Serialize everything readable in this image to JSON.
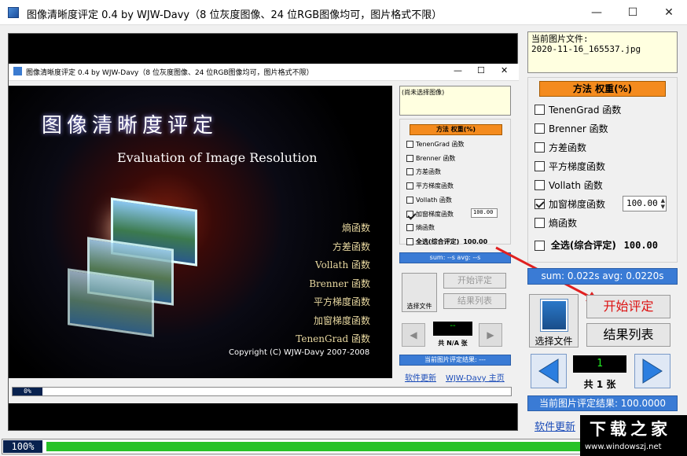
{
  "window": {
    "title": "图像清晰度评定 0.4 by WJW-Davy（8 位灰度图像、24 位RGB图像均可，图片格式不限）",
    "minimize": "—",
    "maximize": "☐",
    "close": "✕"
  },
  "current_file": {
    "label": "当前图片文件:",
    "value": "2020-11-16_165537.jpg"
  },
  "methods": {
    "header": "方法  权重(%)",
    "items": [
      {
        "label": "TenenGrad 函数",
        "checked": false
      },
      {
        "label": "Brenner 函数",
        "checked": false
      },
      {
        "label": "方差函数",
        "checked": false
      },
      {
        "label": "平方梯度函数",
        "checked": false
      },
      {
        "label": "Vollath 函数",
        "checked": false
      },
      {
        "label": "加窗梯度函数",
        "checked": true
      },
      {
        "label": "熵函数",
        "checked": false
      }
    ],
    "weight": "100.00",
    "select_all": "全选(综合评定)",
    "select_all_value": "100.00"
  },
  "stats": "sum: 0.022s  avg: 0.0220s",
  "buttons": {
    "choose_file": "选择文件",
    "start": "开始评定",
    "results": "结果列表"
  },
  "nav": {
    "counter": "1",
    "total": "共 1 张"
  },
  "result_bar": "当前图片评定结果: 100.0000",
  "links": {
    "update": "软件更新"
  },
  "progress": {
    "outer_label": "100%",
    "outer_value": 1.0
  },
  "inner": {
    "title": "图像清晰度评定 0.4 by WJW-Davy（8 位灰度图像、24 位RGB图像均可，图片格式不限）",
    "note": "(尚未选择图像)",
    "methods_header": "方法  权重(%)",
    "items": [
      {
        "label": "TenenGrad 函数",
        "checked": false
      },
      {
        "label": "Brenner 函数",
        "checked": false
      },
      {
        "label": "方差函数",
        "checked": false
      },
      {
        "label": "平方梯度函数",
        "checked": false
      },
      {
        "label": "Vollath 函数",
        "checked": false
      },
      {
        "label": "加窗梯度函数",
        "checked": true
      },
      {
        "label": "熵函数",
        "checked": false
      }
    ],
    "weight": "100.00",
    "select_all": "全选(综合评定)",
    "select_all_value": "100.00",
    "stats": "sum: --s  avg: --s",
    "choose_file": "选择文件",
    "start": "开始评定",
    "results": "结果列表",
    "counter": "--",
    "total": "共 N/A 张",
    "result_bar": "当前图片评定结果: ---",
    "update": "软件更新",
    "homepage": "WJW-Davy 主页",
    "progress_label": "0%"
  },
  "splash": {
    "title": "图像清晰度评定",
    "subtitle": "Evaluation of Image Resolution",
    "list": [
      "熵函数",
      "方差函数",
      "Vollath 函数",
      "Brenner 函数",
      "平方梯度函数",
      "加窗梯度函数",
      "TenenGrad 函数"
    ],
    "copyright": "Copyright (C) WJW-Davy 2007-2008"
  },
  "watermark": {
    "name": "下载之家",
    "url": "www.windowszj.net"
  }
}
